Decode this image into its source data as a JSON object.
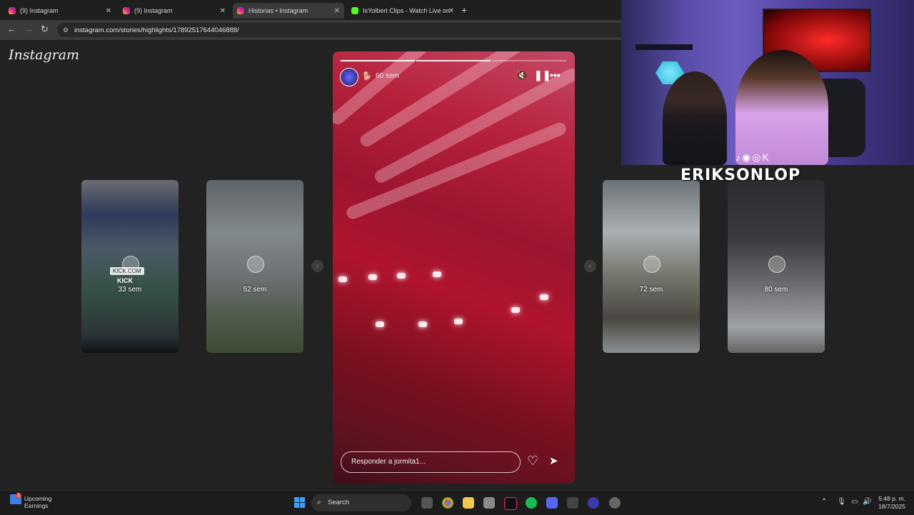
{
  "tabs": [
    {
      "title": "(9) Instagram",
      "favicon": "instagram-icon"
    },
    {
      "title": "(9) Instagram",
      "favicon": "instagram-icon"
    },
    {
      "title": "Historias • Instagram",
      "favicon": "instagram-icon",
      "active": true
    },
    {
      "title": "IsYolbert Clips - Watch Live on",
      "favicon": "kick-icon"
    }
  ],
  "address": {
    "url": "instagram.com/stories/highlights/17892517644046888/"
  },
  "instagram": {
    "logo_text": "Instagram"
  },
  "stories": {
    "thumbnails": [
      {
        "label": "33 sem",
        "overlay_link": "KICK.COM",
        "overlay_text": "KICK"
      },
      {
        "label": "52 sem"
      },
      {
        "label": "72 sem"
      },
      {
        "label": "80 sem"
      }
    ],
    "main": {
      "time_label": "60 sem",
      "reply_placeholder": "Responder a jormita1...",
      "progress_segments": 3,
      "progress_done": 2
    }
  },
  "webcam": {
    "streamer_name": "ERIKSONLOP",
    "accent": "#b98ae0"
  },
  "taskbar": {
    "widget_title": "Upcoming",
    "widget_subtitle": "Earnings",
    "widget_badge": "1",
    "search_label": "Search",
    "time": "5:48 p. m.",
    "date": "18/7/2025"
  }
}
